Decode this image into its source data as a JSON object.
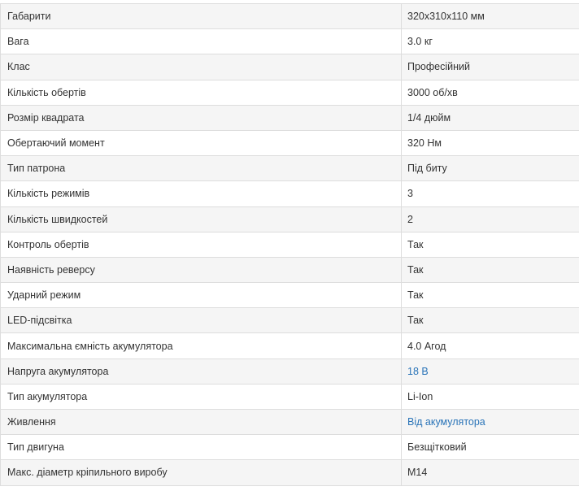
{
  "specs": [
    {
      "name": "Габарити",
      "value": "320x310x110 мм",
      "link": false
    },
    {
      "name": "Вага",
      "value": "3.0 кг",
      "link": false
    },
    {
      "name": "Клас",
      "value": "Професійний",
      "link": false
    },
    {
      "name": "Кількість обертів",
      "value": "3000 об/хв",
      "link": false
    },
    {
      "name": "Розмір квадрата",
      "value": "1/4 дюйм",
      "link": false
    },
    {
      "name": "Обертаючий момент",
      "value": "320 Нм",
      "link": false
    },
    {
      "name": "Тип патрона",
      "value": "Під биту",
      "link": false
    },
    {
      "name": "Кількість режимів",
      "value": "3",
      "link": false
    },
    {
      "name": "Кількість швидкостей",
      "value": "2",
      "link": false
    },
    {
      "name": "Контроль обертів",
      "value": "Так",
      "link": false
    },
    {
      "name": "Наявність реверсу",
      "value": "Так",
      "link": false
    },
    {
      "name": "Ударний режим",
      "value": "Так",
      "link": false
    },
    {
      "name": "LED-підсвітка",
      "value": "Так",
      "link": false
    },
    {
      "name": "Максимальна ємність акумулятора",
      "value": "4.0 Агод",
      "link": false
    },
    {
      "name": "Напруга акумулятора",
      "value": "18 В",
      "link": true
    },
    {
      "name": "Тип акумулятора",
      "value": "Li-Ion",
      "link": false
    },
    {
      "name": "Живлення",
      "value": "Від акумулятора",
      "link": true
    },
    {
      "name": "Тип двигуна",
      "value": "Безщітковий",
      "link": false
    },
    {
      "name": "Макс. діаметр кріпильного виробу",
      "value": "M14",
      "link": false
    }
  ],
  "colors": {
    "link": "#2a74b8",
    "text": "#333333",
    "row_alt": "#f5f5f5",
    "border": "#dddddd"
  }
}
